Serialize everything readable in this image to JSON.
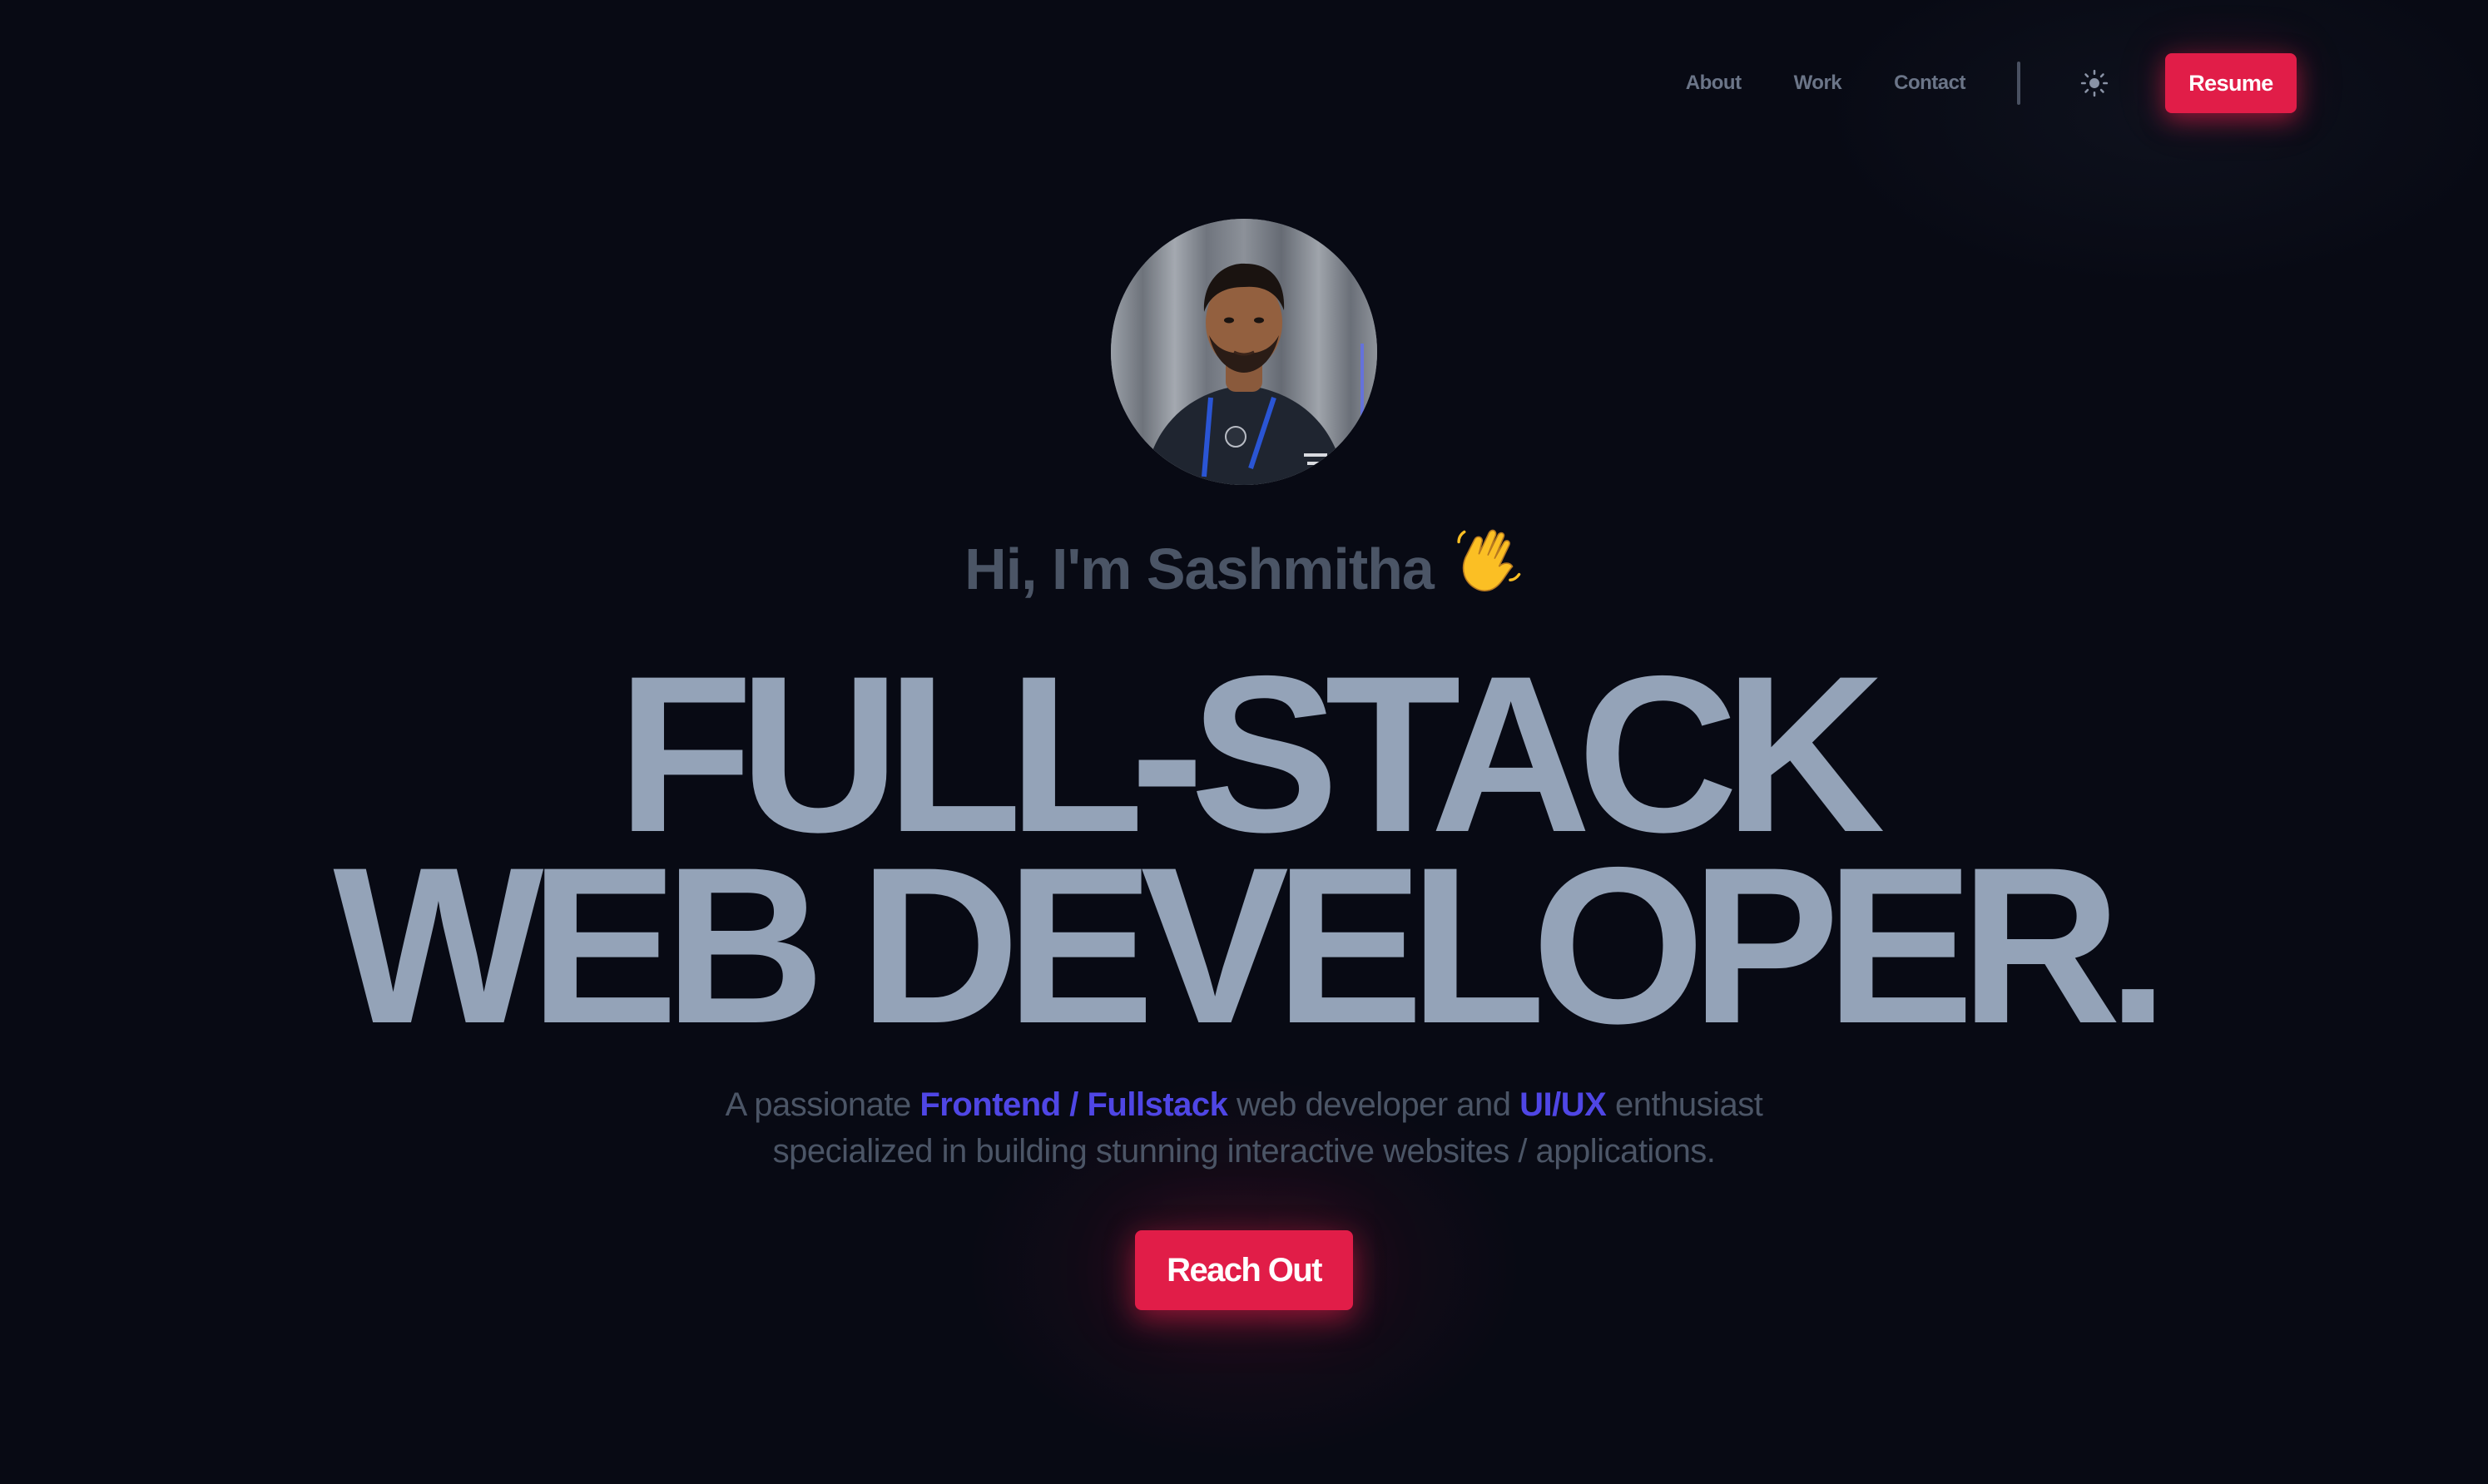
{
  "nav": {
    "links": [
      "About",
      "Work",
      "Contact"
    ],
    "theme_toggle_icon": "sun-icon",
    "resume_label": "Resume"
  },
  "hero": {
    "avatar_icon": "profile-photo",
    "greeting": "Hi, I'm Sashmitha",
    "greeting_emoji": "👋",
    "headline_line1": "FULL-STACK",
    "headline_line2": "WEB DEVELOPER.",
    "tagline": {
      "part1": "A passionate ",
      "highlight1": "Frontend / Fullstack",
      "part2": " web developer and ",
      "highlight2": "UI/UX",
      "part3": " enthusiast",
      "line2": "specialized in building stunning interactive websites / applications."
    },
    "cta_label": "Reach Out"
  },
  "colors": {
    "background": "#080a14",
    "accent": "#e11d48",
    "highlight": "#4f46e5",
    "headline": "#94a3b8",
    "muted": "#4b5566"
  }
}
